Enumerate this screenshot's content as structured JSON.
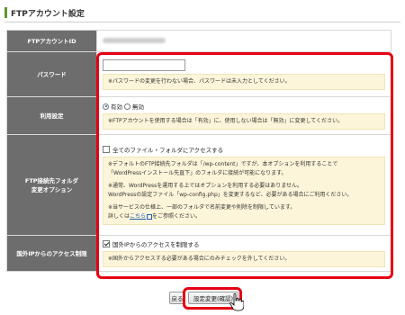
{
  "page_title": "FTPアカウント設定",
  "rows": {
    "account_id": {
      "label": "FTPアカウントID"
    },
    "password": {
      "label": "パスワード",
      "input_value": "",
      "note": "※パスワードの変更を行わない場合、パスワードは未入力としてください。"
    },
    "usage": {
      "label": "利用設定",
      "option_enabled": "有効",
      "option_disabled": "無効",
      "selected": "有効",
      "note": "※FTPアカウントを使用する場合は「有効」に、使用しない場合は「無効」に変更してください。"
    },
    "folder": {
      "label_line1": "FTP接続先フォルダ",
      "label_line2": "変更オプション",
      "checkbox_label": "全てのファイル・フォルダにアクセスする",
      "checked": false,
      "note_p1_line1": "※デフォルトのFTP接続先フォルダは「/wp-content」ですが、本オプションを利用することで",
      "note_p1_line2": "「WordPressインストール先直下」のフォルダに接続が可能になります。",
      "note_p2_line1": "※通常、WordPressを運用する上ではオプションを利用する必要はありません。",
      "note_p2_line2": "WordPressの設定ファイル「wp-config.php」を変更するなど、必要がある場合にご利用ください。",
      "note_p3_line1": "※当サービスの仕様上、一部のフォルダで名前変更や削除を制限しています。",
      "note_p3_line2_prefix": "詳しくは",
      "note_p3_link": "こちら",
      "note_p3_line2_suffix": "をご参照ください。"
    },
    "foreign_ip": {
      "label": "国外IPからのアクセス制限",
      "checkbox_label": "国外IPからのアクセスを制限する",
      "checked": true,
      "note": "※国外からアクセスする必要がある場合にのみチェックを外してください。"
    }
  },
  "buttons": {
    "back": "戻る",
    "submit": "設定変更(確認)"
  },
  "colors": {
    "label_bg": "#6d6d6d",
    "note_bg": "#fdf5d9",
    "highlight_red": "#e60012",
    "accent_green": "#5b9a2c"
  }
}
